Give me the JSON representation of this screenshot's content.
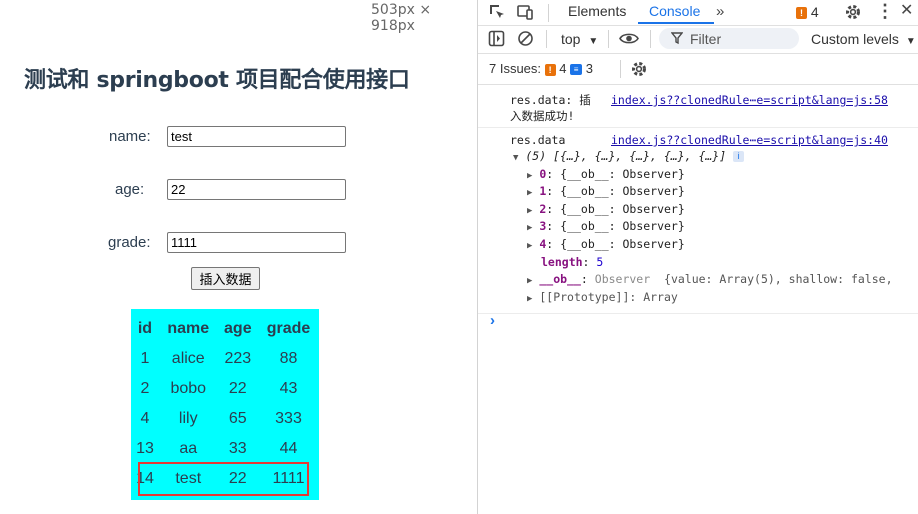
{
  "app": {
    "viewport_label": "503px × 918px",
    "title": "测试和 springboot 项目配合使用接口",
    "form": {
      "name_label": "name:",
      "name_value": "test",
      "age_label": "age:",
      "age_value": "22",
      "grade_label": "grade:",
      "grade_value": "1111",
      "insert_button": "插入数据"
    },
    "table": {
      "background": "#00ffff",
      "headers": [
        "id",
        "name",
        "age",
        "grade"
      ],
      "rows": [
        [
          "1",
          "alice",
          "223",
          "88"
        ],
        [
          "2",
          "bobo",
          "22",
          "43"
        ],
        [
          "4",
          "lily",
          "65",
          "333"
        ],
        [
          "13",
          "aa",
          "33",
          "44"
        ],
        [
          "14",
          "test",
          "22",
          "1111"
        ]
      ],
      "highlight_color": "#e53935"
    }
  },
  "devtools": {
    "tabs": [
      "Elements",
      "Console"
    ],
    "active_tab": "Console",
    "more_icon": "double-chevron-right",
    "warn_count": "4",
    "context": "top",
    "filter_placeholder": "Filter",
    "levels": "Custom levels",
    "issues_label": "7 Issues:",
    "issues_warn": "4",
    "issues_info": "3",
    "accent": "#1a73e8",
    "console": {
      "msg1_text_1": "res.data: 插",
      "msg1_text_2": "入数据成功!",
      "msg1_source": "index.js??clonedRule⋯e=script&lang=js:58",
      "msg2_text": "res.data",
      "msg2_source": "index.js??clonedRule⋯e=script&lang=js:40",
      "array_summary": "(5) [{…}, {…}, {…}, {…}, {…}]",
      "items": [
        {
          "idx": "0",
          "val": "{__ob__: Observer}"
        },
        {
          "idx": "1",
          "val": "{__ob__: Observer}"
        },
        {
          "idx": "2",
          "val": "{__ob__: Observer}"
        },
        {
          "idx": "3",
          "val": "{__ob__: Observer}"
        },
        {
          "idx": "4",
          "val": "{__ob__: Observer}"
        }
      ],
      "length_key": "length",
      "length_val": "5",
      "ob_key": "__ob__",
      "ob_val": "Observer",
      "ob_detail": "{value: Array(5), shallow: false,",
      "proto": "[[Prototype]]: Array",
      "prompt": "›"
    }
  }
}
